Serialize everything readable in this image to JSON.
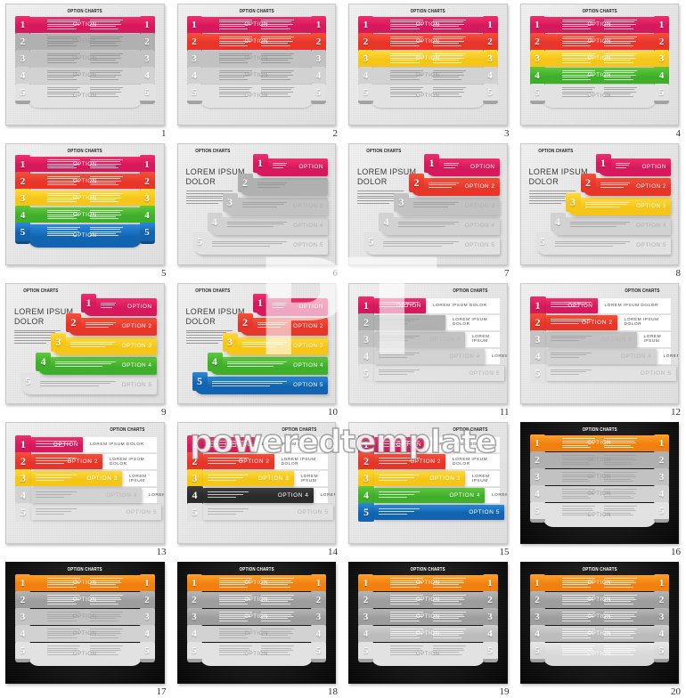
{
  "page": {
    "watermark_logo": "PT",
    "watermark_text": "poweredtemplate",
    "grid_columns": 4,
    "grid_rows": 5
  },
  "labels": {
    "title": "OPTION CHARTS",
    "heading_line1": "LOREM IPSUM",
    "heading_line2": "DOLOR",
    "option": "OPTION",
    "option1": "OPTION",
    "option2": "OPTION 2",
    "option3": "OPTION 3",
    "option4": "OPTION 4",
    "option5": "OPTION 5",
    "side_text_full": "LOREM IPSUM DOLOR",
    "side_text_short": "LOREM IPSUM",
    "side_text_tiny": "LOREM"
  },
  "colors": {
    "pink": "#d6185c",
    "pink_light": "#ef2f6b",
    "red": "#e8352a",
    "red_light": "#f4503a",
    "yellow": "#f5c518",
    "yellow_light": "#ffd93b",
    "green": "#3fae2a",
    "green_light": "#5fc93d",
    "blue": "#1263b0",
    "blue_light": "#2a8ad8",
    "orange": "#f08010",
    "orange_light": "#ffa128",
    "grey": "#9d9d9d",
    "grey_light": "#bcbcbc",
    "grey_pale": "#d8d8d8",
    "dark": "#2b2b2b",
    "black": "#0a0a0a",
    "white": "#ffffff"
  },
  "slides": [
    {
      "n": "1",
      "type": "A",
      "theme": "light",
      "active": 1,
      "palette": "pink"
    },
    {
      "n": "2",
      "type": "A",
      "theme": "light",
      "active": 2,
      "palette": "warm"
    },
    {
      "n": "3",
      "type": "A",
      "theme": "light",
      "active": 3,
      "palette": "warm"
    },
    {
      "n": "4",
      "type": "A",
      "theme": "light",
      "active": 4,
      "palette": "rainbow"
    },
    {
      "n": "5",
      "type": "A",
      "theme": "light",
      "active": 5,
      "palette": "rainbow"
    },
    {
      "n": "6",
      "type": "B",
      "theme": "light",
      "active": 1,
      "palette": "pink"
    },
    {
      "n": "7",
      "type": "B",
      "theme": "light",
      "active": 2,
      "palette": "warm"
    },
    {
      "n": "8",
      "type": "B",
      "theme": "light",
      "active": 3,
      "palette": "warm"
    },
    {
      "n": "9",
      "type": "B",
      "theme": "light",
      "active": 4,
      "palette": "rainbow"
    },
    {
      "n": "10",
      "type": "B",
      "theme": "light",
      "active": 5,
      "palette": "rainbow"
    },
    {
      "n": "11",
      "type": "C",
      "theme": "light",
      "active": 1,
      "palette": "mono"
    },
    {
      "n": "12",
      "type": "C",
      "theme": "light",
      "active": 2,
      "palette": "mono"
    },
    {
      "n": "13",
      "type": "C",
      "theme": "light",
      "active": 3,
      "palette": "mono"
    },
    {
      "n": "14",
      "type": "C",
      "theme": "light",
      "active": 4,
      "palette": "mono"
    },
    {
      "n": "15",
      "type": "C",
      "theme": "light",
      "active": 5,
      "palette": "rainbow"
    },
    {
      "n": "16",
      "type": "A",
      "theme": "dark",
      "active": 1,
      "palette": "orange"
    },
    {
      "n": "17",
      "type": "A",
      "theme": "dark",
      "active": 2,
      "palette": "orange"
    },
    {
      "n": "18",
      "type": "A",
      "theme": "dark",
      "active": 3,
      "palette": "orange"
    },
    {
      "n": "19",
      "type": "A",
      "theme": "dark",
      "active": 4,
      "palette": "orange"
    },
    {
      "n": "20",
      "type": "A",
      "theme": "dark",
      "active": 5,
      "palette": "orange"
    }
  ],
  "option_labels_by_index": [
    "OPTION",
    "OPTION",
    "OPTION",
    "OPTION",
    "OPTION"
  ],
  "option_labels_stair": [
    "OPTION",
    "OPTION 2",
    "OPTION 3",
    "OPTION 4",
    "OPTION 5"
  ],
  "side_texts": [
    "LOREM IPSUM DOLOR",
    "LOREM IPSUM DOLOR",
    "LOREM IPSUM",
    "LOREM",
    ""
  ]
}
